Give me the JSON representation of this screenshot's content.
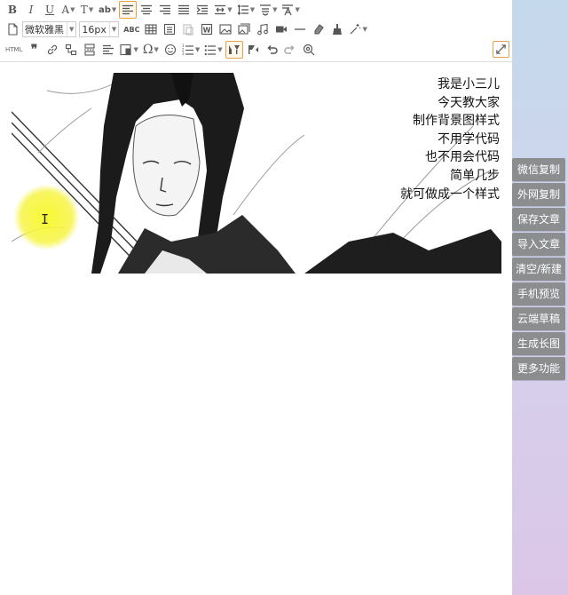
{
  "toolbar": {
    "font_family": "微软雅黑",
    "font_size": "16px",
    "abc_label": "ABC",
    "html_label": "HTML",
    "omega_label": "Ω"
  },
  "banner": {
    "lines": [
      "我是小三儿",
      "今天教大家",
      "制作背景图样式",
      "不用学代码",
      "也不用会代码",
      "简单几步",
      "就可做成一个样式"
    ]
  },
  "cursor": {
    "glyph": "I"
  },
  "side_menu": {
    "items": [
      "微信复制",
      "外网复制",
      "保存文章",
      "导入文章",
      "清空/新建",
      "手机预览",
      "云端草稿",
      "生成长图",
      "更多功能"
    ]
  },
  "colors": {
    "side_button": "#8c8d8f",
    "toolbar_active_border": "#e4a14c",
    "background_top": "#c4d9ec",
    "background_bottom": "#dcc6e8"
  }
}
